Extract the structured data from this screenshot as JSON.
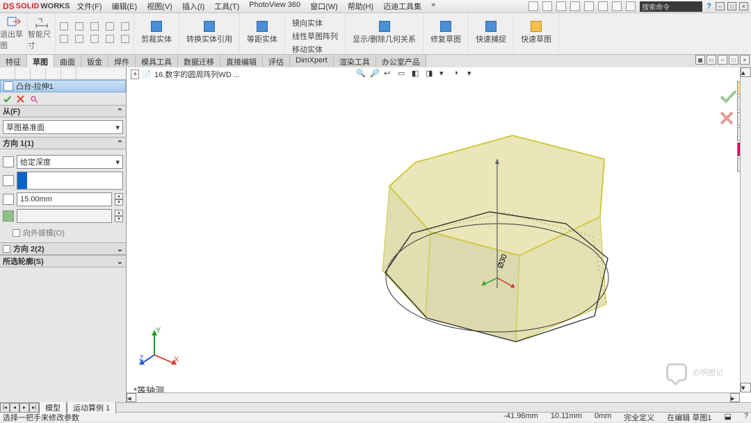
{
  "app": {
    "brand_ds": "DS",
    "brand1": "SOLID",
    "brand2": "WORKS",
    "search_placeholder": "搜索命令"
  },
  "menu": [
    "文件(F)",
    "编辑(E)",
    "视图(V)",
    "插入(I)",
    "工具(T)",
    "PhotoView 360",
    "窗口(W)",
    "帮助(H)",
    "迈迪工具集"
  ],
  "ribbon": {
    "big1": "退出草图",
    "big2": "智能尺寸",
    "trim": "剪裁实体",
    "convert": "转换实体引用",
    "offset": "等距实体",
    "pattern_group": [
      "镜向实体",
      "线性草图阵列",
      "移动实体"
    ],
    "display": "显示/删除几何关系",
    "repair": "修复草图",
    "quick": "快速捕捉",
    "rapid": "快速草图"
  },
  "ribtabs": [
    "特征",
    "草图",
    "曲面",
    "钣金",
    "焊件",
    "模具工具",
    "数据迁移",
    "直接编辑",
    "评估",
    "DimXpert",
    "渲染工具",
    "办公室产品"
  ],
  "ribtab_active": 1,
  "doc_title": "16.数字的圆周阵列WD ...",
  "feature": {
    "title": "凸台-拉伸1",
    "from_label": "从(F)",
    "from_value": "草图基准面",
    "dir1_label": "方向 1(1)",
    "dir1_type": "给定深度",
    "dir1_depth": "15.00mm",
    "draft_label": "向外拔模(O)",
    "dir2_label": "方向 2(2)",
    "sel_label": "所选轮廓(S)"
  },
  "viewport": {
    "dim": "Ø30",
    "view_name": "*等轴测"
  },
  "tabs": {
    "model": "模型",
    "study": "运动算例 1"
  },
  "status": {
    "hint": "选择一把手来修改参数",
    "x": "-41.96mm",
    "y": "10.11mm",
    "z": "0mm",
    "def": "完全定义",
    "mode": "在编辑 草图1"
  },
  "watermark": "亦明图记"
}
